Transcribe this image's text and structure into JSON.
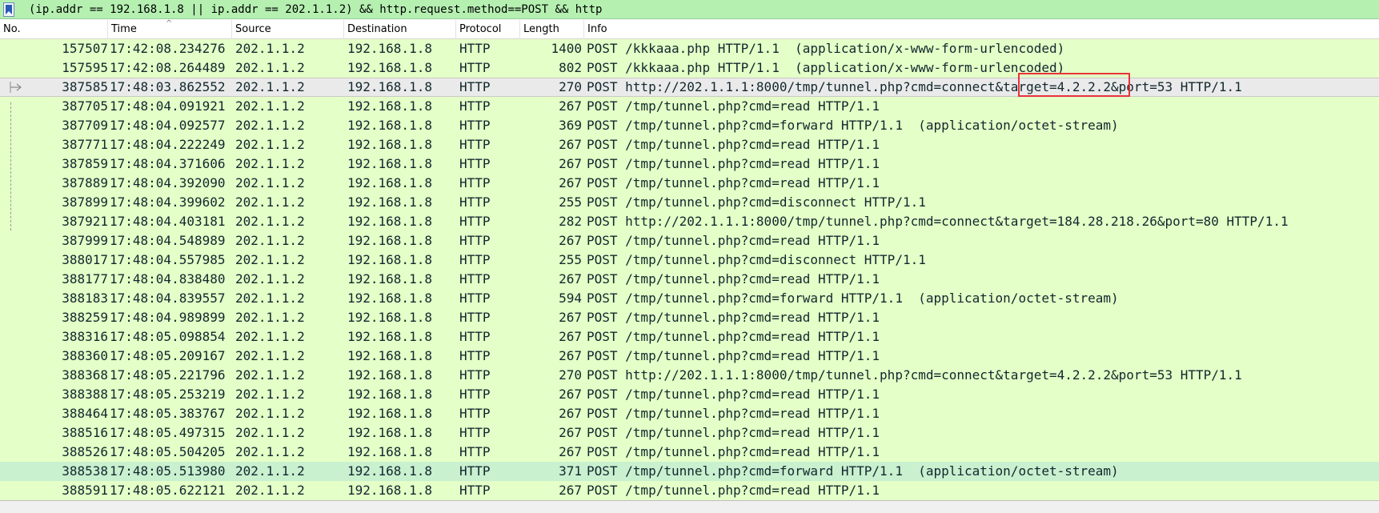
{
  "filter": {
    "expression": "(ip.addr == 192.168.1.8 || ip.addr == 202.1.1.2) && http.request.method==POST && http",
    "bookmark_icon": "bookmark-icon"
  },
  "columns": [
    {
      "label": "No."
    },
    {
      "label": "Time"
    },
    {
      "label": "Source"
    },
    {
      "label": "Destination"
    },
    {
      "label": "Protocol"
    },
    {
      "label": "Length"
    },
    {
      "label": "Info"
    }
  ],
  "sort_indicator": "^",
  "colors": {
    "filter_bg": "#b5f0b1",
    "row_bg": "#e4ffc7",
    "selected_row_bg": "#eaeaea",
    "highlight_row_bg": "#c9f0cf",
    "annotation_box": "#e8333a"
  },
  "packets": [
    {
      "no": "157507",
      "time": "17:42:08.234276",
      "src": "202.1.1.2",
      "dst": "192.168.1.8",
      "proto": "HTTP",
      "len": "1400",
      "info": "POST /kkkaaa.php HTTP/1.1  (application/x-www-form-urlencoded)"
    },
    {
      "no": "157595",
      "time": "17:42:08.264489",
      "src": "202.1.1.2",
      "dst": "192.168.1.8",
      "proto": "HTTP",
      "len": "802",
      "info": "POST /kkkaaa.php HTTP/1.1  (application/x-www-form-urlencoded)"
    },
    {
      "no": "387585",
      "time": "17:48:03.862552",
      "src": "202.1.1.2",
      "dst": "192.168.1.8",
      "proto": "HTTP",
      "len": "270",
      "info": "POST http://202.1.1.1:8000/tmp/tunnel.php?cmd=connect&target=4.2.2.2&port=53 HTTP/1.1",
      "selected": true
    },
    {
      "no": "387705",
      "time": "17:48:04.091921",
      "src": "202.1.1.2",
      "dst": "192.168.1.8",
      "proto": "HTTP",
      "len": "267",
      "info": "POST /tmp/tunnel.php?cmd=read HTTP/1.1"
    },
    {
      "no": "387709",
      "time": "17:48:04.092577",
      "src": "202.1.1.2",
      "dst": "192.168.1.8",
      "proto": "HTTP",
      "len": "369",
      "info": "POST /tmp/tunnel.php?cmd=forward HTTP/1.1  (application/octet-stream)"
    },
    {
      "no": "387771",
      "time": "17:48:04.222249",
      "src": "202.1.1.2",
      "dst": "192.168.1.8",
      "proto": "HTTP",
      "len": "267",
      "info": "POST /tmp/tunnel.php?cmd=read HTTP/1.1"
    },
    {
      "no": "387859",
      "time": "17:48:04.371606",
      "src": "202.1.1.2",
      "dst": "192.168.1.8",
      "proto": "HTTP",
      "len": "267",
      "info": "POST /tmp/tunnel.php?cmd=read HTTP/1.1"
    },
    {
      "no": "387889",
      "time": "17:48:04.392090",
      "src": "202.1.1.2",
      "dst": "192.168.1.8",
      "proto": "HTTP",
      "len": "267",
      "info": "POST /tmp/tunnel.php?cmd=read HTTP/1.1"
    },
    {
      "no": "387899",
      "time": "17:48:04.399602",
      "src": "202.1.1.2",
      "dst": "192.168.1.8",
      "proto": "HTTP",
      "len": "255",
      "info": "POST /tmp/tunnel.php?cmd=disconnect HTTP/1.1"
    },
    {
      "no": "387921",
      "time": "17:48:04.403181",
      "src": "202.1.1.2",
      "dst": "192.168.1.8",
      "proto": "HTTP",
      "len": "282",
      "info": "POST http://202.1.1.1:8000/tmp/tunnel.php?cmd=connect&target=184.28.218.26&port=80 HTTP/1.1"
    },
    {
      "no": "387999",
      "time": "17:48:04.548989",
      "src": "202.1.1.2",
      "dst": "192.168.1.8",
      "proto": "HTTP",
      "len": "267",
      "info": "POST /tmp/tunnel.php?cmd=read HTTP/1.1"
    },
    {
      "no": "388017",
      "time": "17:48:04.557985",
      "src": "202.1.1.2",
      "dst": "192.168.1.8",
      "proto": "HTTP",
      "len": "255",
      "info": "POST /tmp/tunnel.php?cmd=disconnect HTTP/1.1"
    },
    {
      "no": "388177",
      "time": "17:48:04.838480",
      "src": "202.1.1.2",
      "dst": "192.168.1.8",
      "proto": "HTTP",
      "len": "267",
      "info": "POST /tmp/tunnel.php?cmd=read HTTP/1.1"
    },
    {
      "no": "388183",
      "time": "17:48:04.839557",
      "src": "202.1.1.2",
      "dst": "192.168.1.8",
      "proto": "HTTP",
      "len": "594",
      "info": "POST /tmp/tunnel.php?cmd=forward HTTP/1.1  (application/octet-stream)"
    },
    {
      "no": "388259",
      "time": "17:48:04.989899",
      "src": "202.1.1.2",
      "dst": "192.168.1.8",
      "proto": "HTTP",
      "len": "267",
      "info": "POST /tmp/tunnel.php?cmd=read HTTP/1.1"
    },
    {
      "no": "388316",
      "time": "17:48:05.098854",
      "src": "202.1.1.2",
      "dst": "192.168.1.8",
      "proto": "HTTP",
      "len": "267",
      "info": "POST /tmp/tunnel.php?cmd=read HTTP/1.1"
    },
    {
      "no": "388360",
      "time": "17:48:05.209167",
      "src": "202.1.1.2",
      "dst": "192.168.1.8",
      "proto": "HTTP",
      "len": "267",
      "info": "POST /tmp/tunnel.php?cmd=read HTTP/1.1"
    },
    {
      "no": "388368",
      "time": "17:48:05.221796",
      "src": "202.1.1.2",
      "dst": "192.168.1.8",
      "proto": "HTTP",
      "len": "270",
      "info": "POST http://202.1.1.1:8000/tmp/tunnel.php?cmd=connect&target=4.2.2.2&port=53 HTTP/1.1"
    },
    {
      "no": "388388",
      "time": "17:48:05.253219",
      "src": "202.1.1.2",
      "dst": "192.168.1.8",
      "proto": "HTTP",
      "len": "267",
      "info": "POST /tmp/tunnel.php?cmd=read HTTP/1.1"
    },
    {
      "no": "388464",
      "time": "17:48:05.383767",
      "src": "202.1.1.2",
      "dst": "192.168.1.8",
      "proto": "HTTP",
      "len": "267",
      "info": "POST /tmp/tunnel.php?cmd=read HTTP/1.1"
    },
    {
      "no": "388516",
      "time": "17:48:05.497315",
      "src": "202.1.1.2",
      "dst": "192.168.1.8",
      "proto": "HTTP",
      "len": "267",
      "info": "POST /tmp/tunnel.php?cmd=read HTTP/1.1"
    },
    {
      "no": "388526",
      "time": "17:48:05.504205",
      "src": "202.1.1.2",
      "dst": "192.168.1.8",
      "proto": "HTTP",
      "len": "267",
      "info": "POST /tmp/tunnel.php?cmd=read HTTP/1.1"
    },
    {
      "no": "388538",
      "time": "17:48:05.513980",
      "src": "202.1.1.2",
      "dst": "192.168.1.8",
      "proto": "HTTP",
      "len": "371",
      "info": "POST /tmp/tunnel.php?cmd=forward HTTP/1.1  (application/octet-stream)",
      "highlighted": true
    },
    {
      "no": "388591",
      "time": "17:48:05.622121",
      "src": "202.1.1.2",
      "dst": "192.168.1.8",
      "proto": "HTTP",
      "len": "267",
      "info": "POST /tmp/tunnel.php?cmd=read HTTP/1.1"
    }
  ]
}
